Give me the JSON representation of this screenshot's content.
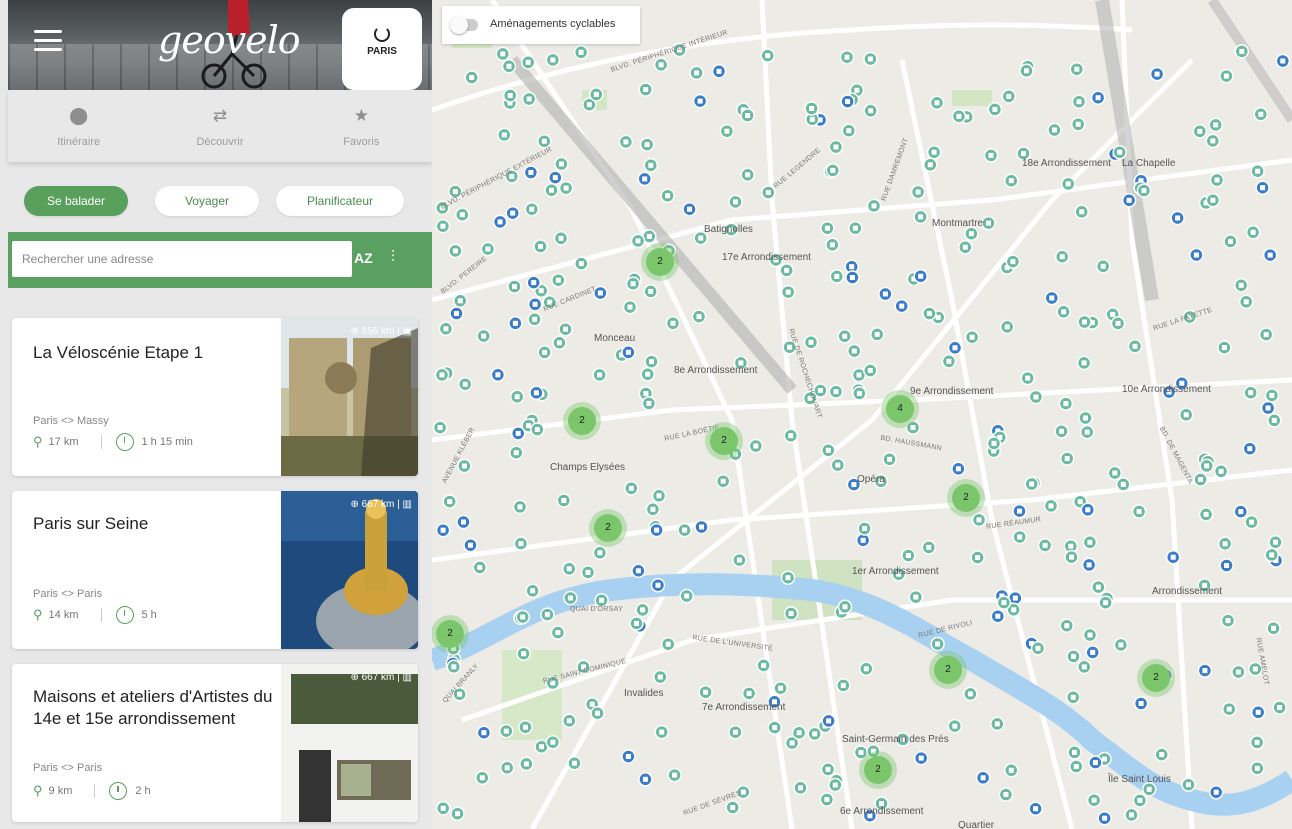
{
  "brand": {
    "logo": "geovelo",
    "city": "PARIS"
  },
  "nav": [
    {
      "id": "itinerary",
      "label": "Itinéraire",
      "icon": "location-pin-icon"
    },
    {
      "id": "discover",
      "label": "Découvrir",
      "icon": "route-icon"
    },
    {
      "id": "favorites",
      "label": "Favoris",
      "icon": "star-icon"
    }
  ],
  "modes": [
    {
      "label": "Se balader",
      "active": true
    },
    {
      "label": "Voyager",
      "active": false
    },
    {
      "label": "Planificateur",
      "active": false
    }
  ],
  "search": {
    "placeholder": "Rechercher une adresse",
    "sort_label": "AZ",
    "filter_label": "⫶"
  },
  "cards": [
    {
      "title": "La Véloscénie Etape 1",
      "route": "Paris <> Massy",
      "distance": "17 km",
      "duration": "1 h 15 min",
      "badge": "⊕ 656 km | ▣"
    },
    {
      "title": "Paris sur Seine",
      "route": "Paris <> Paris",
      "distance": "14 km",
      "duration": "5 h",
      "badge": "⊕ 667 km | ▥"
    },
    {
      "title": "Maisons et ateliers d'Artistes du 14e et 15e arrondissement",
      "route": "Paris <> Paris",
      "distance": "9 km",
      "duration": "2 h",
      "badge": "⊕ 667 km | ▥"
    }
  ],
  "map": {
    "toggle_label": "Aménagements cyclables",
    "toggle_on": false,
    "places": [
      "18e Arrondissement",
      "La Chapelle",
      "Batignolles",
      "17e Arrondissement",
      "Montmartre",
      "8e Arrondissement",
      "9e Arrondissement",
      "10e Arrondissement",
      "Champs Elysées",
      "Opéra",
      "1er Arrondissement",
      "Arrondissement",
      "Invalides",
      "7e Arrondissement",
      "Saint-Germain des Prés",
      "6e Arrondissement",
      "Île Saint Louis",
      "Quartier",
      "Monceau"
    ],
    "streets": [
      "BLVD. PÉRIPHÉRIQUE INTÉRIEUR",
      "BLVD. PÉRIPHÉRIQUE EXTÉRIEUR",
      "BLVD. PEREIRE",
      "RUE CARDINET",
      "RUE LEGENDRE",
      "RUE DAMREMONT",
      "RUE LA BOÉTIE",
      "BD. HAUSSMANN",
      "QUAI D'ORSAY",
      "RUE DE L'UNIVERSITÉ",
      "RUE SAINT-DOMINIQUE",
      "QUAI BRANLY",
      "RUE DE ROCHECHOUART",
      "RUE LA FAYETTE",
      "RUE DE SÈVRES",
      "AVENUE KLÉBER",
      "BD. DE MAGENTA",
      "RUE DE RIVOLI",
      "RUE RÉAUMUR",
      "RUE AMELOT"
    ],
    "clusters": [
      {
        "count": "2"
      },
      {
        "count": "2"
      },
      {
        "count": "2"
      },
      {
        "count": "4"
      },
      {
        "count": "2"
      },
      {
        "count": "2"
      },
      {
        "count": "2"
      },
      {
        "count": "2"
      },
      {
        "count": "2"
      },
      {
        "count": "2"
      }
    ]
  },
  "colors": {
    "brand_green": "#5aa060",
    "marker_green": "#6cb9a1",
    "marker_blue": "#3b7cc9",
    "seine": "#a8d0f0"
  }
}
